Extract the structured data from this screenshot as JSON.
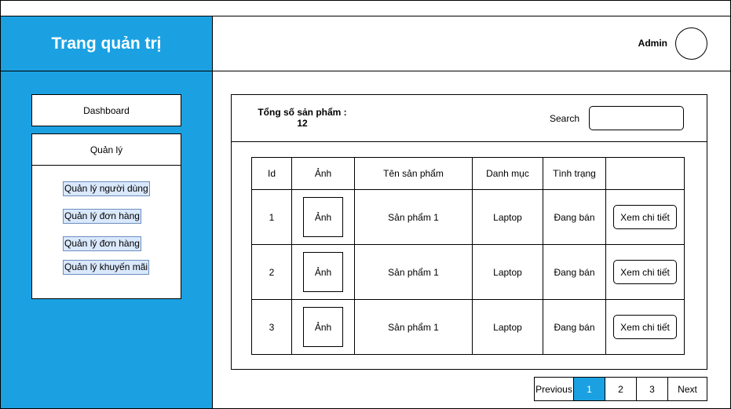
{
  "app": {
    "title": "Trang quản trị",
    "user": "Admin"
  },
  "sidebar": {
    "dashboard": "Dashboard",
    "manage": "Quản lý",
    "sub_items": [
      "Quản lý người dùng",
      "Quản lý đơn hàng",
      "Quản lý đơn hàng",
      "Quản lý khuyến mãi"
    ]
  },
  "summary": {
    "label": "Tổng số sản phẩm :",
    "count": "12"
  },
  "search": {
    "label": "Search",
    "value": "",
    "placeholder": ""
  },
  "table": {
    "headers": [
      "Id",
      "Ảnh",
      "Tên sản phẩm",
      "Danh mục",
      "Tình trạng",
      ""
    ],
    "rows": [
      {
        "id": "1",
        "image": "Ảnh",
        "name": "Sản phẩm 1",
        "category": "Laptop",
        "status": "Đang bán",
        "action": "Xem chi tiết"
      },
      {
        "id": "2",
        "image": "Ảnh",
        "name": "Sản phẩm 1",
        "category": "Laptop",
        "status": "Đang bán",
        "action": "Xem chi tiết"
      },
      {
        "id": "3",
        "image": "Ảnh",
        "name": "Sản phẩm 1",
        "category": "Laptop",
        "status": "Đang bán",
        "action": "Xem chi tiết"
      }
    ]
  },
  "pagination": {
    "previous": "Previous",
    "pages": [
      "1",
      "2",
      "3"
    ],
    "current": "1",
    "next": "Next"
  },
  "colors": {
    "accent": "#1ba1e2",
    "sub_item_bg": "#dae8fc",
    "sub_item_border": "#6c8ebf"
  }
}
